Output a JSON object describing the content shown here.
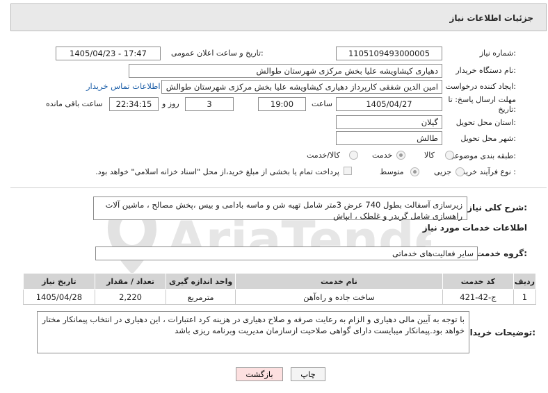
{
  "panel": {
    "title": "جزئیات اطلاعات نیاز"
  },
  "fields": {
    "need_number_label": "شماره نیاز:",
    "need_number": "1105109493000005",
    "announce_label": "تاریخ و ساعت اعلان عمومی:",
    "announce_value": "1405/04/23 - 17:47",
    "buyer_org_label": "نام دستگاه خریدار:",
    "buyer_org": "دهیاری کیشاویشه علیا بخش مرکزی شهرستان طوالش",
    "creator_label": "ایجاد کننده درخواست:",
    "creator": "امین الدین شفقی کارپرداز دهیاری کیشاویشه علیا بخش مرکزی شهرستان طوالش",
    "contact_link": "اطلاعات تماس خریدار",
    "deadline_label": "مهلت ارسال پاسخ: تا تاریخ:",
    "deadline_date": "1405/04/27",
    "time_label": "ساعت",
    "deadline_time": "19:00",
    "days_value": "3",
    "days_label": "روز و",
    "remaining_time": "22:34:15",
    "remaining_label": "ساعت باقی مانده",
    "province_label": "استان محل تحویل:",
    "province": "گیلان",
    "city_label": "شهر محل تحویل:",
    "city": "طالش",
    "category_label": "طبقه بندی موضوعی:",
    "category_options": [
      "کالا",
      "خدمت",
      "کالا/خدمت"
    ],
    "purchase_type_label": "نوع فرآیند خرید :",
    "purchase_options": [
      "جزیی",
      "متوسط"
    ],
    "payment_note": "پرداخت تمام یا بخشی از مبلغ خرید،از محل \"اسناد خزانه اسلامی\" خواهد بود."
  },
  "description": {
    "label": "شرح کلی نیاز:",
    "text": "زیرسازی آسفالت بطول 740 عرض 3متر شامل تهیه شن و ماسه بادامی و بیس ،پخش مصالح ، ماشین آلات راهسازی شامل گریدر و غلطک ، ابپاش"
  },
  "services": {
    "section_title": "اطلاعات خدمات مورد نیاز",
    "group_label": "گروه خدمت:",
    "group_value": "سایر فعالیت‌های خدماتی",
    "columns": [
      "ردیف",
      "کد خدمت",
      "نام خدمت",
      "واحد اندازه گیری",
      "تعداد / مقدار",
      "تاریخ نیاز"
    ],
    "rows": [
      [
        "1",
        "ج-42-421",
        "ساخت جاده و راه‌آهن",
        "مترمربع",
        "2,220",
        "1405/04/28"
      ]
    ]
  },
  "buyer_notes": {
    "label": "توضیحات خریدار:",
    "text": "با توجه به آیین مالی دهیاری و الزام به رعایت صرفه و صلاح دهیاری در هزینه کرد اعتبارات ، این دهیاری در انتخاب پیمانکار مختار خواهد بود.پیمانکار میبایست دارای گواهی صلاحیت ازسازمان مدیریت وبرنامه ریزی باشد"
  },
  "buttons": {
    "print": "چاپ",
    "back": "بازگشت"
  },
  "watermark": {
    "text": "AriaTender.net"
  },
  "colors": {
    "link": "#1d5fa8",
    "back_button_bg": "#fde0e0",
    "panel_bg": "#e9e9e9"
  }
}
